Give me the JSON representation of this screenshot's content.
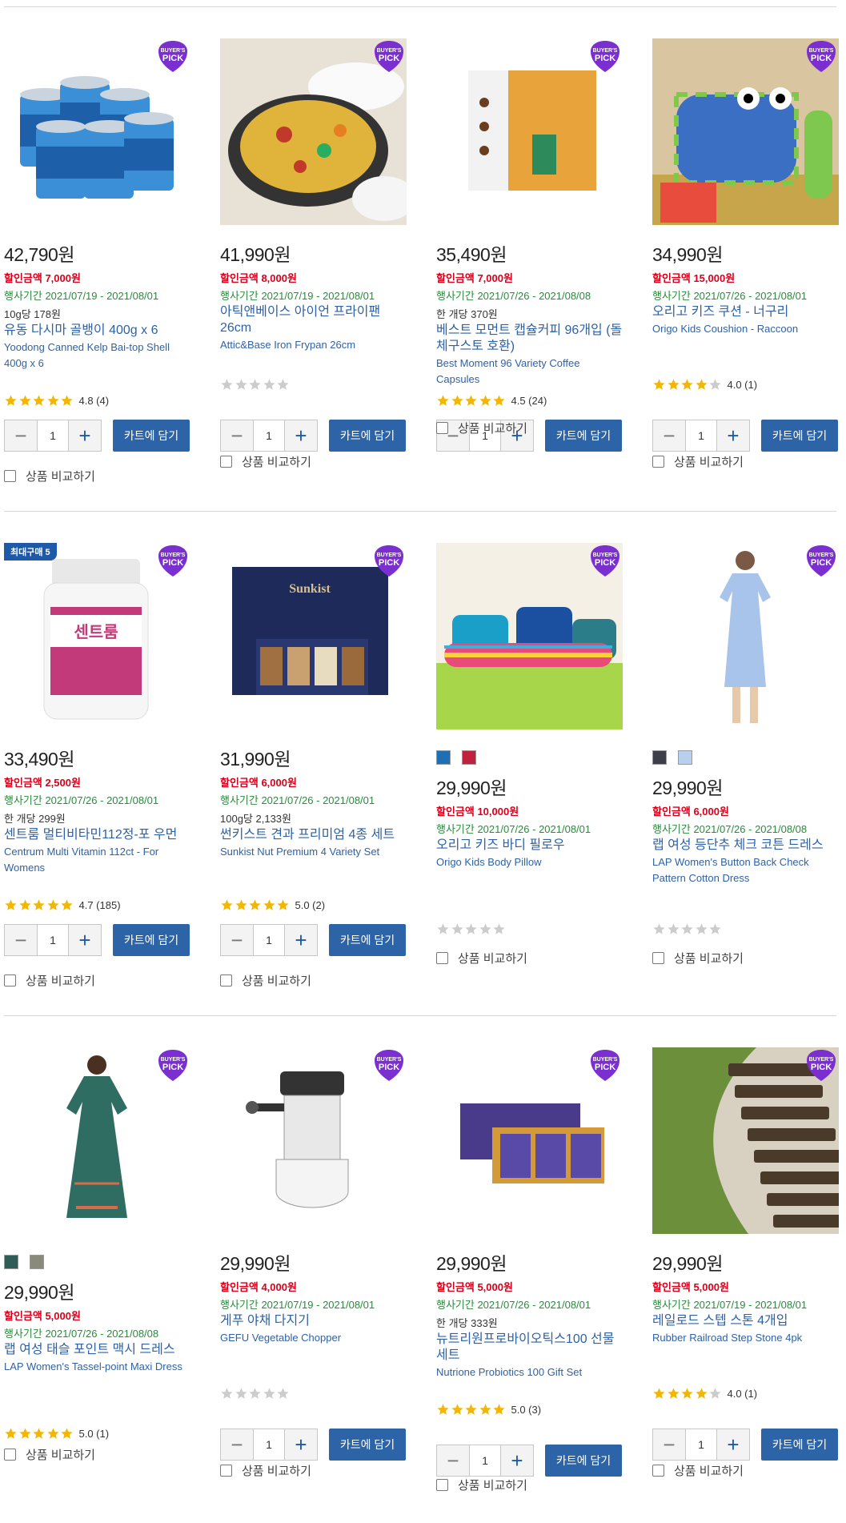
{
  "common": {
    "currency": "원",
    "cart_label": "카트에 담기",
    "compare_label": "상품 비교하기",
    "pick_label_1": "BUYER'S",
    "pick_label_2": "PICK",
    "qty": "1",
    "minus": "−",
    "plus": "+",
    "colors": {
      "pick": "#7b2fd1",
      "cart": "#2d64a8",
      "discount": "#d9001b",
      "period": "#2b8a3e",
      "title": "#2f62a5",
      "star": "#f2b705",
      "star_empty": "#cccccc"
    }
  },
  "products": [
    {
      "price": "42,790원",
      "discount": "할인금액 7,000원",
      "period": "행사기간 2021/07/19 - 2021/08/01",
      "unit": "10g당 178원",
      "title_ko": "유동 다시마 골뱅이 400g x 6",
      "title_en": "Yoodong Canned Kelp Bai-top Shell 400g x 6",
      "rating": "4.8 (4)",
      "stars": 5,
      "image": "canned-shellfish"
    },
    {
      "price": "41,990원",
      "discount": "할인금액 8,000원",
      "period": "행사기간 2021/07/19 - 2021/08/01",
      "unit": "",
      "title_ko": "아틱앤베이스 아이언 프라이팬 26cm",
      "title_en": "Attic&Base Iron Frypan 26cm",
      "rating": "",
      "stars": 0,
      "image": "paella-frypan"
    },
    {
      "price": "35,490원",
      "discount": "할인금액 7,000원",
      "period": "행사기간 2021/07/26 - 2021/08/08",
      "unit": "한 개당 370원",
      "title_ko": "베스트 모먼트 캡슐커피 96개입 (돌체구스토 호환)",
      "title_en": "Best Moment 96 Variety Coffee Capsules",
      "rating": "4.5 (24)",
      "stars": 5,
      "image": "coffee-box"
    },
    {
      "price": "34,990원",
      "discount": "할인금액 15,000원",
      "period": "행사기간 2021/07/26 - 2021/08/01",
      "unit": "",
      "title_ko": "오리고 키즈 쿠션 - 너구리",
      "title_en": "Origo Kids Coushion - Raccoon",
      "rating": "4.0 (1)",
      "stars": 4,
      "image": "kids-cushion"
    },
    {
      "price": "33,490원",
      "discount": "할인금액 2,500원",
      "period": "행사기간 2021/07/26 - 2021/08/01",
      "unit": "한 개당 299원",
      "title_ko": "센트룸 멀티비타민112정-포 우먼",
      "title_en": "Centrum Multi Vitamin 112ct - For Womens",
      "rating": "4.7 (185)",
      "stars": 5,
      "image": "vitamin-bottle",
      "badge": "최대구매 5"
    },
    {
      "price": "31,990원",
      "discount": "할인금액 6,000원",
      "period": "행사기간 2021/07/26 - 2021/08/01",
      "unit": "100g당 2,133원",
      "title_ko": "썬키스트 견과 프리미엄 4종 세트",
      "title_en": "Sunkist Nut Premium 4 Variety Set",
      "rating": "5.0 (2)",
      "stars": 5,
      "image": "nut-set"
    },
    {
      "price": "29,990원",
      "discount": "할인금액 10,000원",
      "period": "행사기간 2021/07/26 - 2021/08/01",
      "unit": "",
      "title_ko": "오리고 키즈 바디 필로우",
      "title_en": "Origo Kids Body Pillow",
      "rating": "",
      "stars": 0,
      "image": "body-pillow",
      "swatches": [
        "#1f6fb5",
        "#c0223b"
      ]
    },
    {
      "price": "29,990원",
      "discount": "할인금액 6,000원",
      "period": "행사기간 2021/07/26 - 2021/08/08",
      "unit": "",
      "title_ko": "랩 여성 등단추 체크 코튼 드레스",
      "title_en": "LAP Women's Button Back Check Pattern Cotton Dress",
      "rating": "",
      "stars": 0,
      "image": "blue-dress",
      "swatches": [
        "#3c3f48",
        "#b9cfee"
      ]
    },
    {
      "price": "29,990원",
      "discount": "할인금액 5,000원",
      "period": "행사기간 2021/07/26 - 2021/08/08",
      "unit": "",
      "title_ko": "랩 여성 태슬 포인트 맥시 드레스",
      "title_en": "LAP Women's Tassel-point Maxi Dress",
      "rating": "5.0 (1)",
      "stars": 5,
      "image": "maxi-dress",
      "swatches": [
        "#2f5d56",
        "#8a8a7a"
      ]
    },
    {
      "price": "29,990원",
      "discount": "할인금액 4,000원",
      "period": "행사기간 2021/07/19 - 2021/08/01",
      "unit": "",
      "title_ko": "게푸 야채 다지기",
      "title_en": "GEFU Vegetable Chopper",
      "rating": "",
      "stars": 0,
      "image": "chopper"
    },
    {
      "price": "29,990원",
      "discount": "할인금액 5,000원",
      "period": "행사기간 2021/07/26 - 2021/08/01",
      "unit": "한 개당 333원",
      "title_ko": "뉴트리원프로바이오틱스100 선물세트",
      "title_en": "Nutrione Probiotics 100 Gift Set",
      "rating": "5.0 (3)",
      "stars": 5,
      "image": "probiotics"
    },
    {
      "price": "29,990원",
      "discount": "할인금액 5,000원",
      "period": "행사기간 2021/07/19 - 2021/08/01",
      "unit": "",
      "title_ko": "레일로드 스텝 스톤 4개입",
      "title_en": "Rubber Railroad Step Stone 4pk",
      "rating": "4.0 (1)",
      "stars": 4,
      "image": "step-stone"
    }
  ]
}
